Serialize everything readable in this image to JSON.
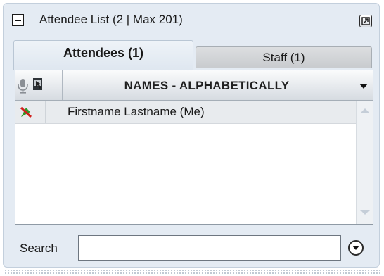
{
  "title": {
    "text": "Attendee List   (2 | Max 201)",
    "collapse_icon": "minus-box-icon",
    "popout_icon": "popout-window-icon"
  },
  "tabs": [
    {
      "label": "Attendees (1)",
      "active": true
    },
    {
      "label": "Staff (1)",
      "active": false
    }
  ],
  "list": {
    "columns": {
      "mic_icon": "microphone-icon",
      "camera_icon": "webcam-icon",
      "names_header": "NAMES - ALPHABETICALLY",
      "sort_icon": "sort-arrow-down-icon"
    },
    "rows": [
      {
        "name": "Firstname Lastname (Me)",
        "mic_icon": "mic-muted-icon"
      }
    ]
  },
  "search": {
    "label": "Search",
    "value": "",
    "go_icon": "dropdown-circle-icon"
  },
  "colors": {
    "panel_bg": "#e4ebf3",
    "mute_red": "#d0201c",
    "mic_green": "#2f9a2a"
  }
}
